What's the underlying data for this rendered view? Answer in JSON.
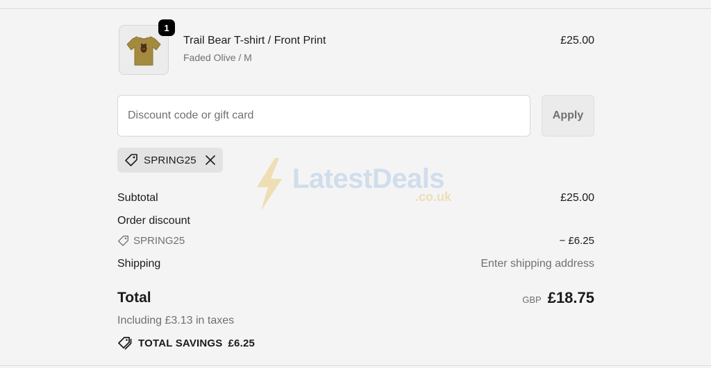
{
  "line_item": {
    "quantity": "1",
    "title": "Trail Bear T-shirt / Front Print",
    "variant": "Faded Olive / M",
    "price": "£25.00",
    "image_icon": "tshirt-icon",
    "image_color": "#a38a3e"
  },
  "discount": {
    "placeholder": "Discount code or gift card",
    "value": "",
    "apply_label": "Apply",
    "applied_code": "SPRING25"
  },
  "summary": {
    "subtotal_label": "Subtotal",
    "subtotal_value": "£25.00",
    "order_discount_label": "Order discount",
    "discount_code": "SPRING25",
    "discount_value": "− £6.25",
    "shipping_label": "Shipping",
    "shipping_value": "Enter shipping address",
    "total_label": "Total",
    "currency": "GBP",
    "total_value": "£18.75",
    "taxes_note": "Including £3.13 in taxes",
    "savings_label": "TOTAL SAVINGS",
    "savings_value": "£6.25"
  },
  "watermark": {
    "name": "LatestDeals",
    "domain": ".co.uk"
  },
  "colors": {
    "background": "#f4f4f4",
    "badge": "#000000",
    "muted_text": "#707070"
  }
}
